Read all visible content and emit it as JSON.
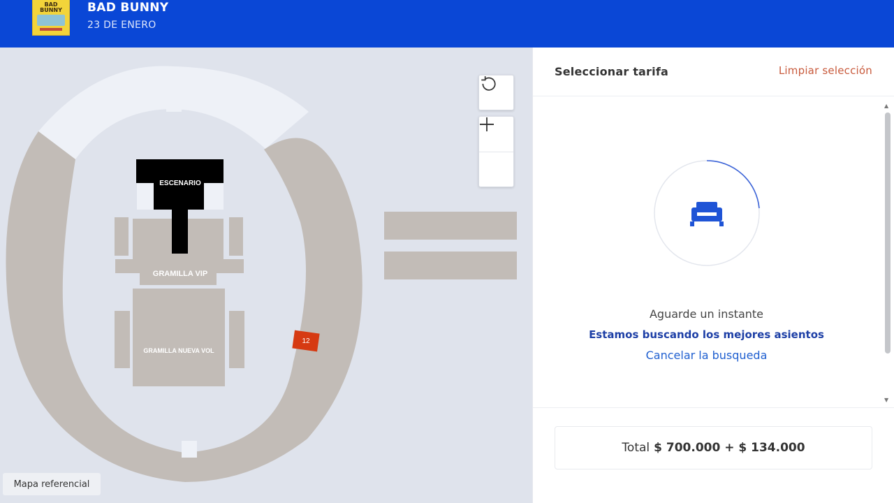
{
  "event": {
    "thumb_text": "BAD BUNNY",
    "title": "BAD BUNNY",
    "date": "23 DE ENERO"
  },
  "map": {
    "stage_label": "ESCENARIO",
    "vip_label": "GRAMILLA VIP",
    "nueva_label": "GRAMILLA NUEVA VOL",
    "reference_label": "Mapa referencial",
    "selected_seat": "12",
    "reset_icon": "rotate-ccw-icon",
    "zoom_in_icon": "plus-icon",
    "zoom_out_icon": "minus-icon",
    "colors": {
      "section": "#c2bcb7",
      "stage": "#000000",
      "selected": "#d63a12",
      "background": "#dfe3ec",
      "upper": "#eef1f7"
    }
  },
  "panel": {
    "title": "Seleccionar tarifa",
    "clear": "Limpiar selección",
    "loader_icon": "seat-icon",
    "wait_line1": "Aguarde un instante",
    "wait_line2": "Estamos buscando los mejores asientos",
    "cancel": "Cancelar la busqueda",
    "total_label": "Total",
    "total_amount": "$ 700.000 + $ 134.000"
  }
}
